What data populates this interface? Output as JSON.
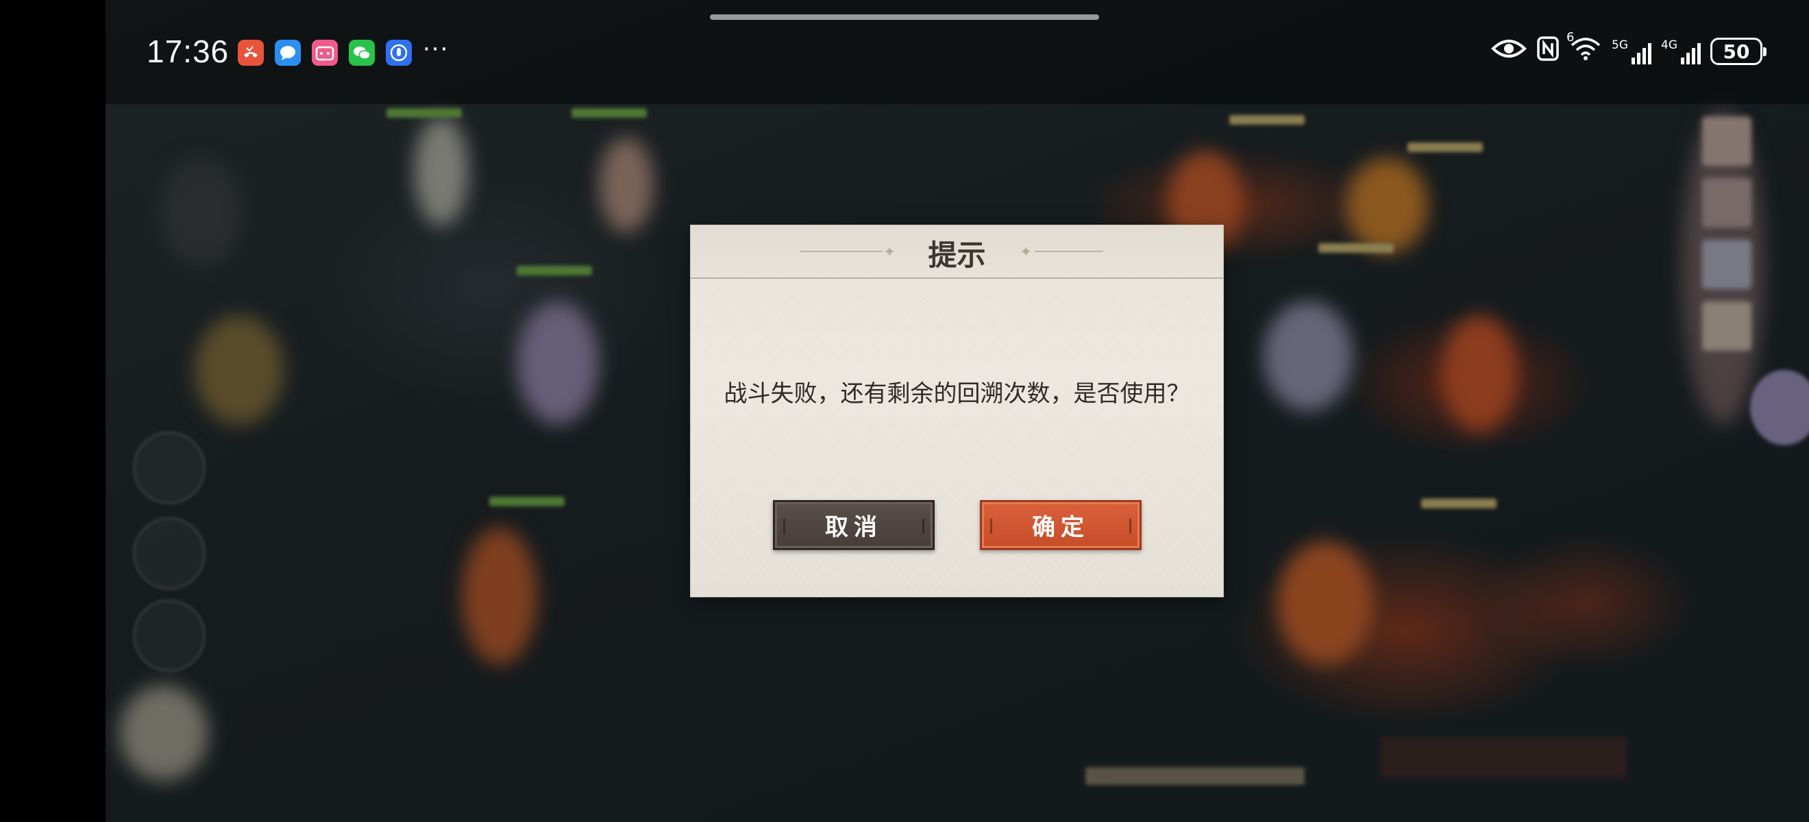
{
  "status_bar": {
    "time": "17:36",
    "more": "···",
    "notification_icons": [
      {
        "name": "missed-call-icon",
        "color": "#e8533b"
      },
      {
        "name": "messages-icon",
        "color": "#2b8ff0"
      },
      {
        "name": "bilibili-icon",
        "color": "#f05a8a"
      },
      {
        "name": "wechat-icon",
        "color": "#29c24a"
      },
      {
        "name": "hand-app-icon",
        "color": "#2f6ff0"
      }
    ],
    "wifi_badge": "6",
    "network_5g": "5G",
    "network_4g": "4G",
    "battery": "50"
  },
  "dialog": {
    "title": "提示",
    "message": "战斗失败，还有剩余的回溯次数，是否使用？",
    "cancel_label": "取消",
    "confirm_label": "确定"
  },
  "colors": {
    "confirm": "#d3582f",
    "cancel": "#4f4541",
    "dialog_bg": "#e9e4dc"
  }
}
